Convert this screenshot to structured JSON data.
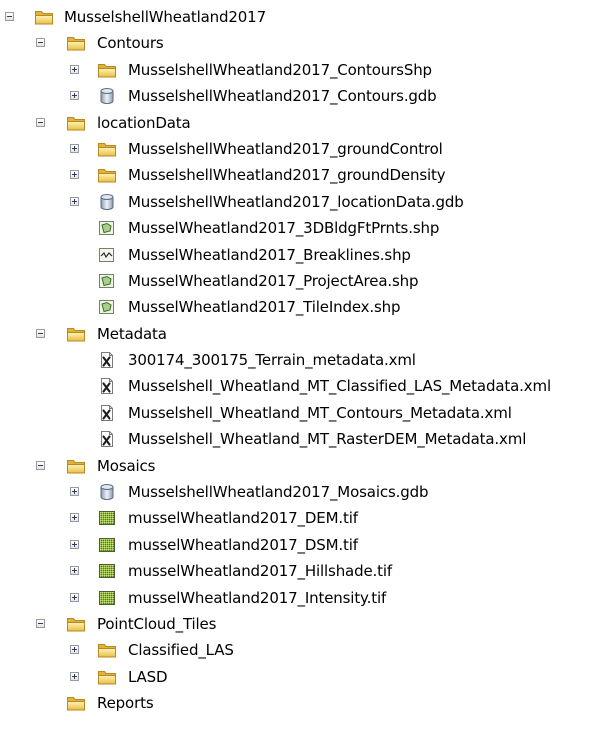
{
  "tree": {
    "root": {
      "label": "MusselshellWheatland2017",
      "icon": "folder-icon",
      "expanded": true,
      "children": [
        {
          "label": "Contours",
          "icon": "folder-icon",
          "expanded": true,
          "children": [
            {
              "label": "MusselshellWheatland2017_ContoursShp",
              "icon": "folder-icon",
              "expandable": true
            },
            {
              "label": "MusselshellWheatland2017_Contours.gdb",
              "icon": "geodatabase-icon",
              "expandable": true
            }
          ]
        },
        {
          "label": "locationData",
          "icon": "folder-icon",
          "expanded": true,
          "children": [
            {
              "label": "MusselshellWheatland2017_groundControl",
              "icon": "folder-icon",
              "expandable": true
            },
            {
              "label": "MusselshellWheatland2017_groundDensity",
              "icon": "folder-icon",
              "expandable": true
            },
            {
              "label": "MusselshellWheatland2017_locationData.gdb",
              "icon": "geodatabase-icon",
              "expandable": true
            },
            {
              "label": "MusselWheatland2017_3DBldgFtPrnts.shp",
              "icon": "polygon-shapefile-icon",
              "expandable": false
            },
            {
              "label": "MusselWheatland2017_Breaklines.shp",
              "icon": "line-shapefile-icon",
              "expandable": false
            },
            {
              "label": "MusselWheatland2017_ProjectArea.shp",
              "icon": "polygon-shapefile-icon",
              "expandable": false
            },
            {
              "label": "MusselWheatland2017_TileIndex.shp",
              "icon": "polygon-shapefile-icon",
              "expandable": false
            }
          ]
        },
        {
          "label": "Metadata",
          "icon": "folder-icon",
          "expanded": true,
          "children": [
            {
              "label": "300174_300175_Terrain_metadata.xml",
              "icon": "xml-file-icon",
              "expandable": false
            },
            {
              "label": "Musselshell_Wheatland_MT_Classified_LAS_Metadata.xml",
              "icon": "xml-file-icon",
              "expandable": false
            },
            {
              "label": "Musselshell_Wheatland_MT_Contours_Metadata.xml",
              "icon": "xml-file-icon",
              "expandable": false
            },
            {
              "label": "Musselshell_Wheatland_MT_RasterDEM_Metadata.xml",
              "icon": "xml-file-icon",
              "expandable": false
            }
          ]
        },
        {
          "label": "Mosaics",
          "icon": "folder-icon",
          "expanded": true,
          "children": [
            {
              "label": "MusselshellWheatland2017_Mosaics.gdb",
              "icon": "geodatabase-icon",
              "expandable": true
            },
            {
              "label": "musselWheatland2017_DEM.tif",
              "icon": "raster-icon",
              "expandable": true
            },
            {
              "label": "musselWheatland2017_DSM.tif",
              "icon": "raster-icon",
              "expandable": true
            },
            {
              "label": "musselWheatland2017_Hillshade.tif",
              "icon": "raster-icon",
              "expandable": true
            },
            {
              "label": "musselWheatland2017_Intensity.tif",
              "icon": "raster-icon",
              "expandable": true
            }
          ]
        },
        {
          "label": "PointCloud_Tiles",
          "icon": "folder-icon",
          "expanded": true,
          "children": [
            {
              "label": "Classified_LAS",
              "icon": "folder-icon",
              "expandable": true
            },
            {
              "label": "LASD",
              "icon": "folder-icon",
              "expandable": true
            }
          ]
        },
        {
          "label": "Reports",
          "icon": "folder-icon",
          "expandable": false
        }
      ]
    }
  }
}
